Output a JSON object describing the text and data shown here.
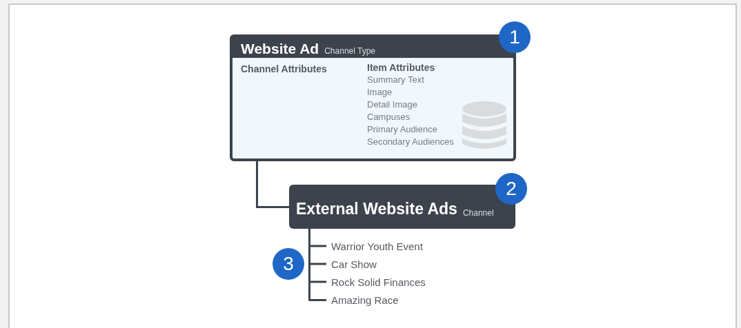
{
  "type_card": {
    "title": "Website Ad",
    "subtitle": "Channel Type",
    "badge": "1",
    "channel_attributes_heading": "Channel Attributes",
    "item_attributes_heading": "Item Attributes",
    "item_attributes": [
      "Summary Text",
      "Image",
      "Detail Image",
      "Campuses",
      "Primary Audience",
      "Secondary Audiences"
    ]
  },
  "channel_card": {
    "title": "External Website Ads",
    "subtitle": "Channel",
    "badge": "2"
  },
  "channel_items": {
    "badge": "3",
    "entries": [
      "Warrior Youth Event",
      "Car Show",
      "Rock Solid Finances",
      "Amazing Race"
    ]
  }
}
